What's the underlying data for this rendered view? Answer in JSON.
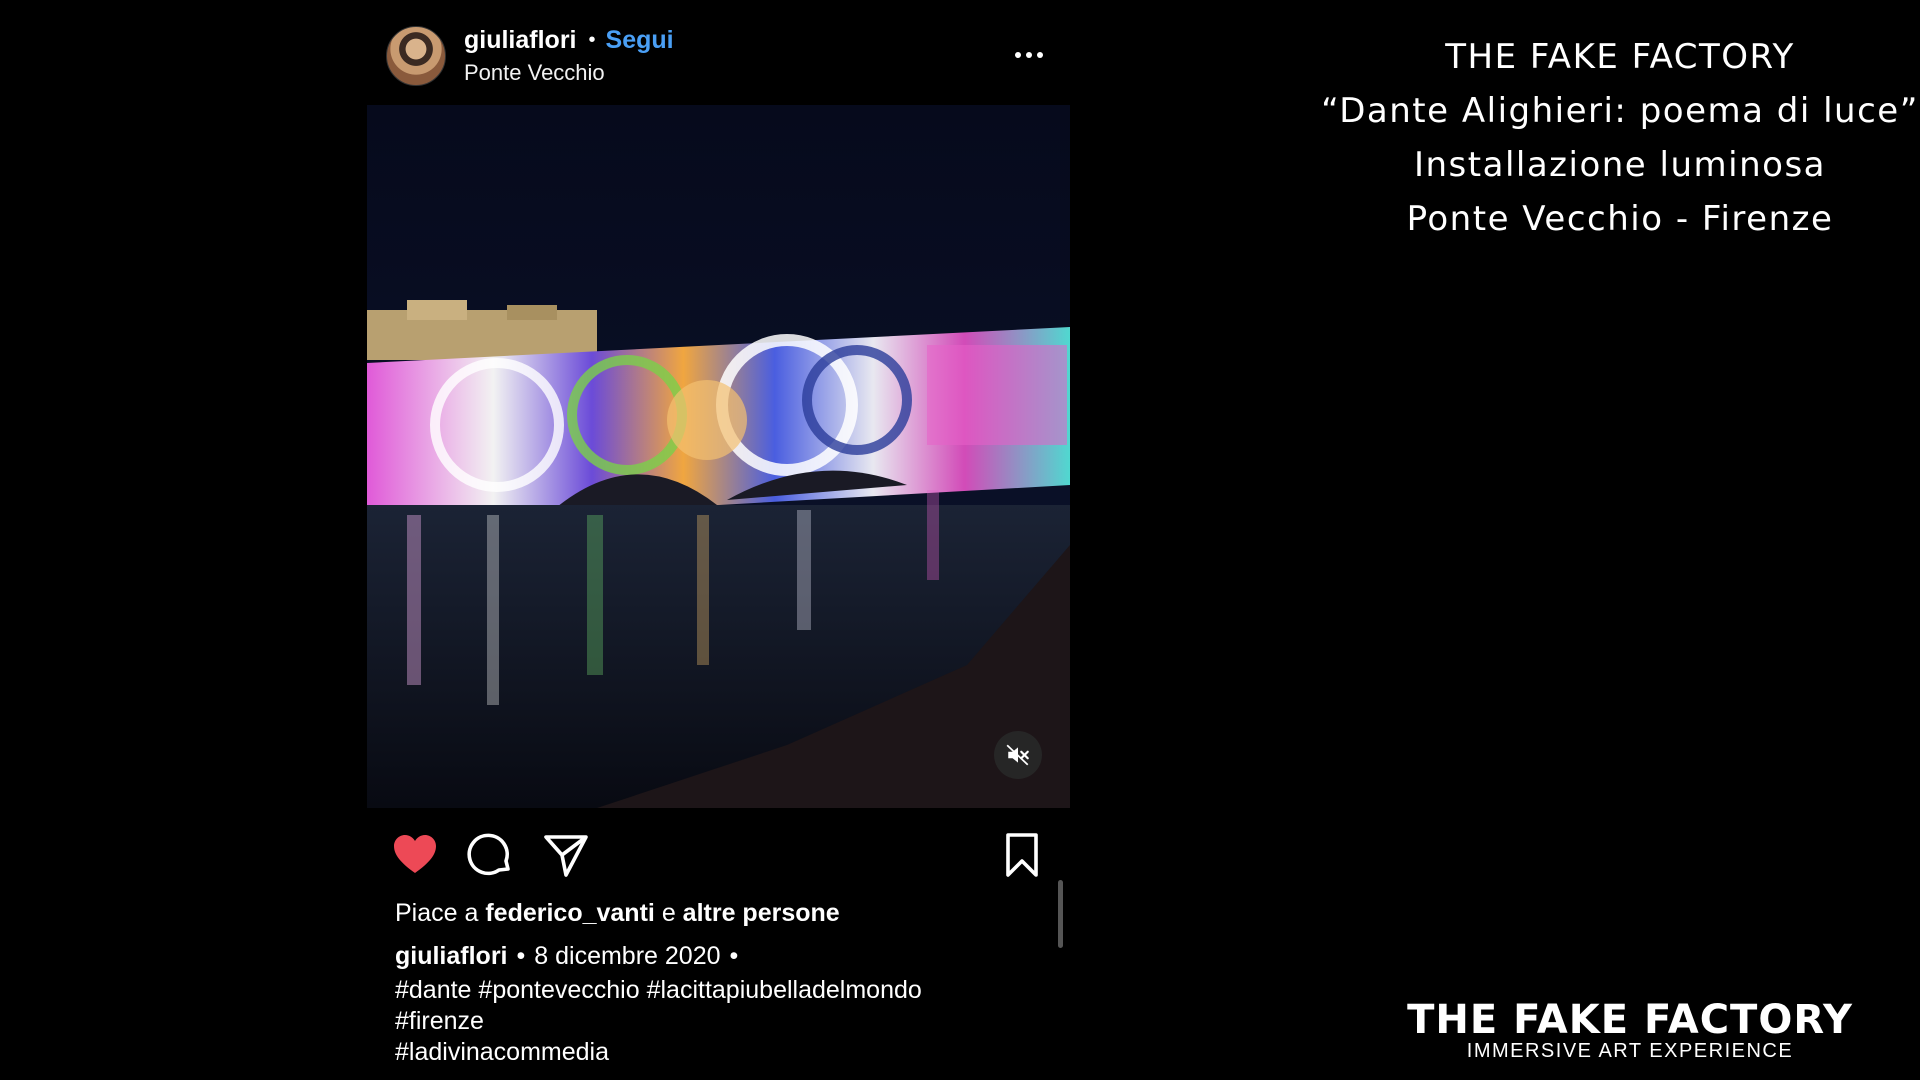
{
  "post": {
    "username": "giuliaflori",
    "separator": "•",
    "follow_label": "Segui",
    "location": "Ponte Vecchio",
    "likes": {
      "prefix": "Piace a",
      "user": "federico_vanti",
      "conjunction": "e",
      "others": "altre persone"
    },
    "caption": {
      "username": "giuliaflori",
      "date": "8 dicembre 2020",
      "separator": "•"
    },
    "hashtags": [
      "#dante #pontevecchio #lacittapiubelladelmondo",
      "#firenze",
      "#ladivinacommedia"
    ],
    "icons": {
      "like": "heart-icon",
      "like_color": "#ed4956",
      "comment": "comment-icon",
      "share": "paper-plane-icon",
      "save": "bookmark-icon",
      "more": "more-horizontal-icon",
      "mute": "speaker-muted-icon"
    },
    "accent_color": "#4a9ff5"
  },
  "info": {
    "lines": [
      "THE FAKE FACTORY",
      "“Dante Alighieri: poema di luce”",
      "Installazione luminosa",
      "Ponte Vecchio - Firenze"
    ]
  },
  "logo": {
    "title": "THE FAKE FACTORY",
    "subtitle": "IMMERSIVE ART EXPERIENCE"
  }
}
